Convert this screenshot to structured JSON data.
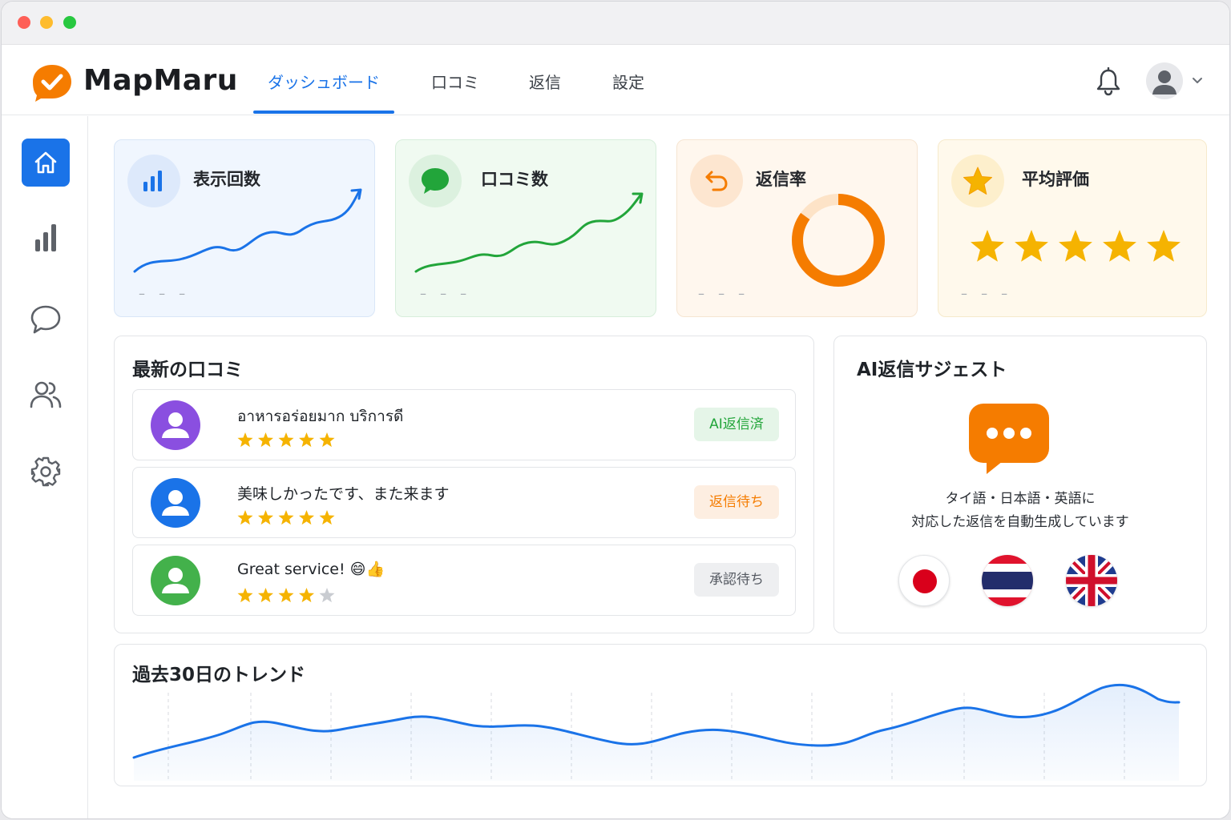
{
  "app": {
    "name": "MapMaru"
  },
  "nav": {
    "tabs": [
      {
        "label": "ダッシュボード",
        "active": true
      },
      {
        "label": "口コミ",
        "active": false
      },
      {
        "label": "返信",
        "active": false
      },
      {
        "label": "設定",
        "active": false
      }
    ]
  },
  "sidebar": {
    "items": [
      {
        "icon": "home-icon",
        "active": true
      },
      {
        "icon": "bar-chart-icon",
        "active": false
      },
      {
        "icon": "chat-bubble-icon",
        "active": false
      },
      {
        "icon": "users-icon",
        "active": false
      },
      {
        "icon": "gear-icon",
        "active": false
      }
    ]
  },
  "stats": [
    {
      "title": "表示回数",
      "icon": "bar-chart-icon",
      "placeholder": "– – –",
      "color": "#1a73e8"
    },
    {
      "title": "口コミ数",
      "icon": "chat-bubble-icon",
      "placeholder": "– – –",
      "color": "#22a53a"
    },
    {
      "title": "返信率",
      "icon": "reply-icon",
      "placeholder": "– – –",
      "color": "#f57c00"
    },
    {
      "title": "平均評価",
      "icon": "star-icon",
      "placeholder": "– – –",
      "rating": 5,
      "color": "#f5b301"
    }
  ],
  "reviews": {
    "title": "最新の口コミ",
    "items": [
      {
        "text": "อาหารอร่อยมาก บริการดี",
        "rating": 5,
        "status": "AI返信済",
        "avatar_color": "#8a4fe0",
        "status_color": "#22a53a",
        "status_bg": "#e5f5e8"
      },
      {
        "text": "美味しかったです、また来ます",
        "rating": 5,
        "status": "返信待ち",
        "avatar_color": "#1a73e8",
        "status_color": "#f57c00",
        "status_bg": "#fdeee1"
      },
      {
        "text": "Great service! 😄👍",
        "rating": 4,
        "status": "承認待ち",
        "avatar_color": "#43b14b",
        "status_color": "#555a62",
        "status_bg": "#eeeff1"
      }
    ]
  },
  "ai_suggest": {
    "title": "AI返信サジェスト",
    "line1": "タイ語・日本語・英語に",
    "line2": "対応した返信を自動生成しています",
    "languages": [
      "japan-flag-icon",
      "thailand-flag-icon",
      "uk-flag-icon"
    ],
    "accent": "#f57c00"
  },
  "trend": {
    "title": "過去30日のトレンド"
  },
  "colors": {
    "primary": "#1a73e8",
    "star": "#f5b301",
    "star_empty": "#c9ccd1"
  }
}
